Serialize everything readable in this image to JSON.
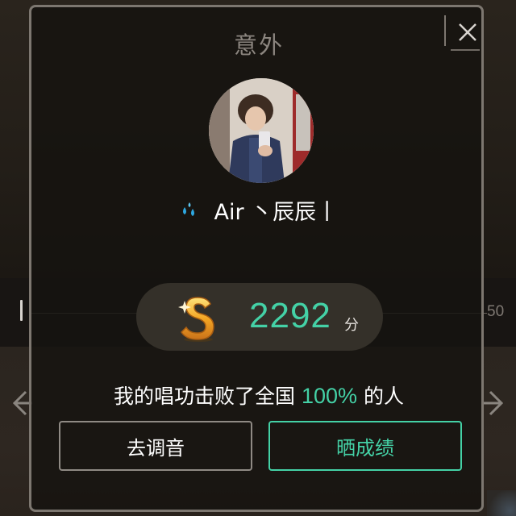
{
  "background": {
    "ruler_end_label": "50"
  },
  "dialog": {
    "title": "意外",
    "close_icon": "close-icon",
    "user": {
      "badge_icon": "water-drops-icon",
      "name": "Air 丶辰辰丨"
    },
    "score": {
      "icon": "gold-s-coin-icon",
      "value": "2292",
      "unit": "分"
    },
    "beat": {
      "prefix": "我的唱功击败了全国",
      "percent": "100%",
      "suffix": "的人"
    },
    "buttons": {
      "tune_label": "去调音",
      "share_label": "晒成绩"
    }
  },
  "colors": {
    "accent": "#44d1a6",
    "dialog_border": "#7d7770",
    "pill_bg": "#343029"
  }
}
